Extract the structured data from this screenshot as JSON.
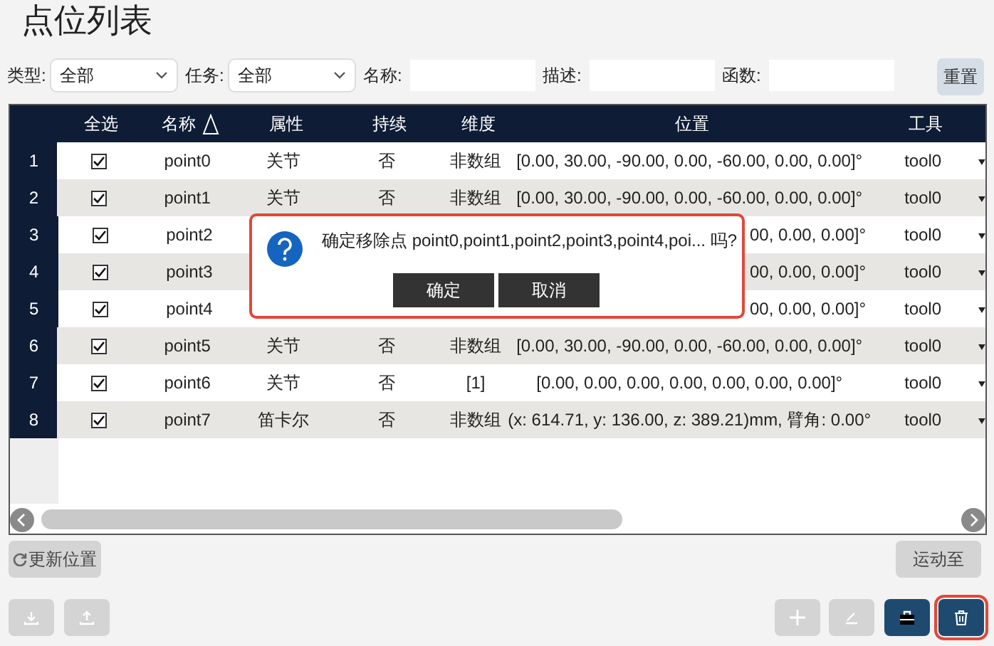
{
  "title": "点位列表",
  "filters": [
    {
      "kind": "select",
      "label": "类型:",
      "value": "全部"
    },
    {
      "kind": "select",
      "label": "任务:",
      "value": "全部"
    },
    {
      "kind": "input",
      "label": "名称:"
    },
    {
      "kind": "input",
      "label": "描述:"
    },
    {
      "kind": "input",
      "label": "函数:"
    }
  ],
  "reset_button": "重置",
  "table": {
    "columns": [
      "全选",
      "名称",
      "属性",
      "持续",
      "维度",
      "位置",
      "工具"
    ],
    "rows": [
      {
        "kind": "full",
        "index": "1",
        "checked": true,
        "name": "point0",
        "attribute": "关节",
        "persistent": "否",
        "dimension": "非数组",
        "position": "[0.00, 30.00, -90.00, 0.00, -60.00, 0.00, 0.00]°",
        "tool": "tool0"
      },
      {
        "kind": "full",
        "index": "2",
        "checked": true,
        "name": "point1",
        "attribute": "关节",
        "persistent": "否",
        "dimension": "非数组",
        "position": "[0.00, 30.00, -90.00, 0.00, -60.00, 0.00, 0.00]°",
        "tool": "tool0"
      },
      {
        "kind": "partly_covered",
        "index": "3",
        "checked": true,
        "name": "point2",
        "position": "00, 0.00, 0.00]°",
        "tool": "tool0"
      },
      {
        "kind": "partly_covered",
        "index": "4",
        "checked": true,
        "name": "point3",
        "position": "00, 0.00, 0.00]°",
        "tool": "tool0"
      },
      {
        "kind": "partly_covered",
        "index": "5",
        "checked": true,
        "name": "point4",
        "position": "00, 0.00, 0.00]°",
        "tool": "tool0"
      },
      {
        "kind": "full",
        "index": "6",
        "checked": true,
        "name": "point5",
        "attribute": "关节",
        "persistent": "否",
        "dimension": "非数组",
        "position": "[0.00, 30.00, -90.00, 0.00, -60.00, 0.00, 0.00]°",
        "tool": "tool0"
      },
      {
        "kind": "full",
        "index": "7",
        "checked": true,
        "name": "point6",
        "attribute": "关节",
        "persistent": "否",
        "dimension": "[1]",
        "position": "[0.00, 0.00, 0.00, 0.00, 0.00, 0.00, 0.00]°",
        "tool": "tool0"
      },
      {
        "kind": "full",
        "index": "8",
        "checked": true,
        "name": "point7",
        "attribute": "笛卡尔",
        "persistent": "否",
        "dimension": "非数组",
        "position": "(x: 614.71, y: 136.00, z: 389.21)mm, 臂角: 0.00°",
        "tool": "tool0"
      }
    ]
  },
  "dialog": {
    "message": "确定移除点 point0,point1,point2,point3,point4,poi... 吗?",
    "buttons": [
      "确定",
      "取消"
    ]
  },
  "update_button": "更新位置",
  "move_button": "运动至",
  "toolbar": [
    {
      "kind": "download",
      "disabled": true
    },
    {
      "kind": "upload",
      "disabled": true
    },
    {
      "kind": "add",
      "disabled": true
    },
    {
      "kind": "edit",
      "disabled": true
    },
    {
      "kind": "toolbox",
      "disabled": false
    },
    {
      "kind": "delete",
      "disabled": false,
      "selected": true
    }
  ]
}
